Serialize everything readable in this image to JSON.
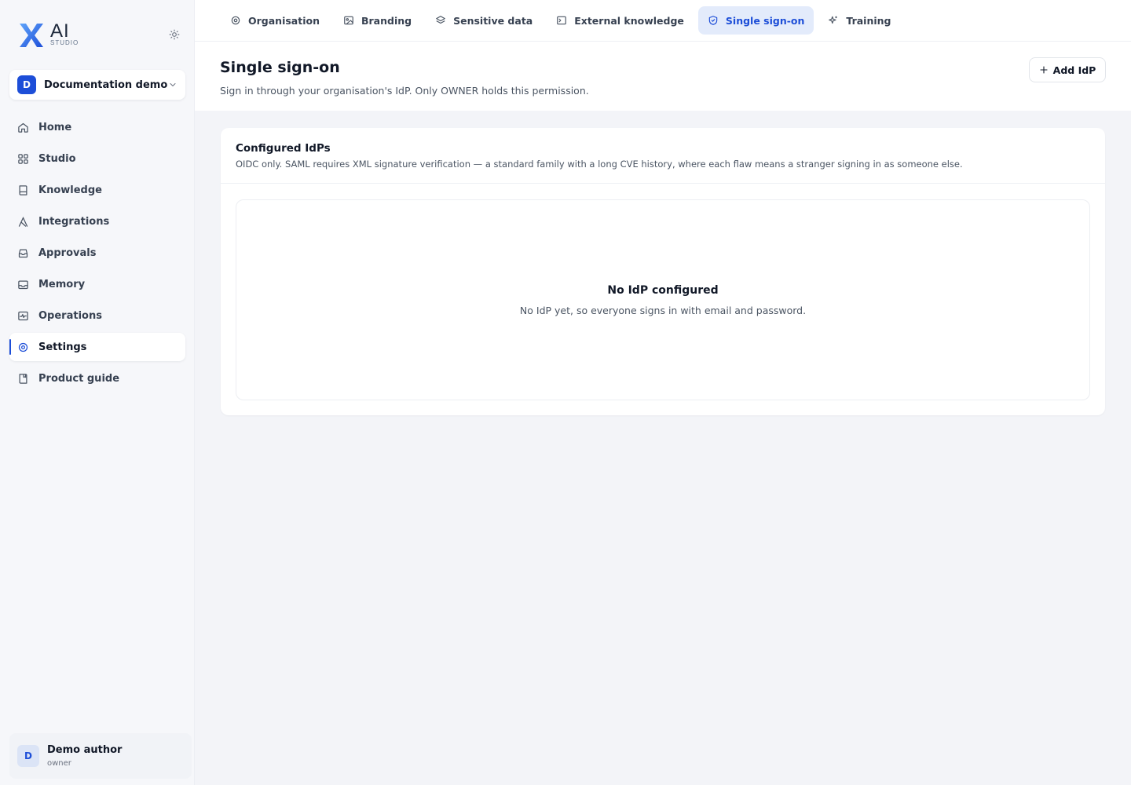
{
  "brand": {
    "logo_text": "AI",
    "logo_sub": "STUDIO",
    "accent": "#1d4ed8"
  },
  "org": {
    "badge": "D",
    "name": "Documentation demo"
  },
  "sidebar": {
    "items": [
      {
        "label": "Home",
        "icon": "home-icon"
      },
      {
        "label": "Studio",
        "icon": "grid-icon"
      },
      {
        "label": "Knowledge",
        "icon": "book-icon"
      },
      {
        "label": "Integrations",
        "icon": "integration-icon"
      },
      {
        "label": "Approvals",
        "icon": "inbox-icon"
      },
      {
        "label": "Memory",
        "icon": "memory-icon"
      },
      {
        "label": "Operations",
        "icon": "activity-icon"
      },
      {
        "label": "Settings",
        "icon": "gear-icon",
        "active": true
      },
      {
        "label": "Product guide",
        "icon": "guide-icon"
      }
    ]
  },
  "user": {
    "initial": "D",
    "name": "Demo author",
    "role": "owner"
  },
  "tabs": [
    {
      "label": "Organisation",
      "icon": "gear-icon"
    },
    {
      "label": "Branding",
      "icon": "image-icon"
    },
    {
      "label": "Sensitive data",
      "icon": "layers-icon"
    },
    {
      "label": "External knowledge",
      "icon": "terminal-icon"
    },
    {
      "label": "Single sign-on",
      "icon": "shield-icon",
      "active": true
    },
    {
      "label": "Training",
      "icon": "sparkle-icon"
    }
  ],
  "page": {
    "title": "Single sign-on",
    "subtitle": "Sign in through your organisation's IdP. Only OWNER holds this permission.",
    "add_label": "Add IdP"
  },
  "card": {
    "title": "Configured IdPs",
    "description": "OIDC only. SAML requires XML signature verification — a standard family with a long CVE history, where each flaw means a stranger signing in as someone else.",
    "empty_title": "No IdP configured",
    "empty_description": "No IdP yet, so everyone signs in with email and password."
  }
}
